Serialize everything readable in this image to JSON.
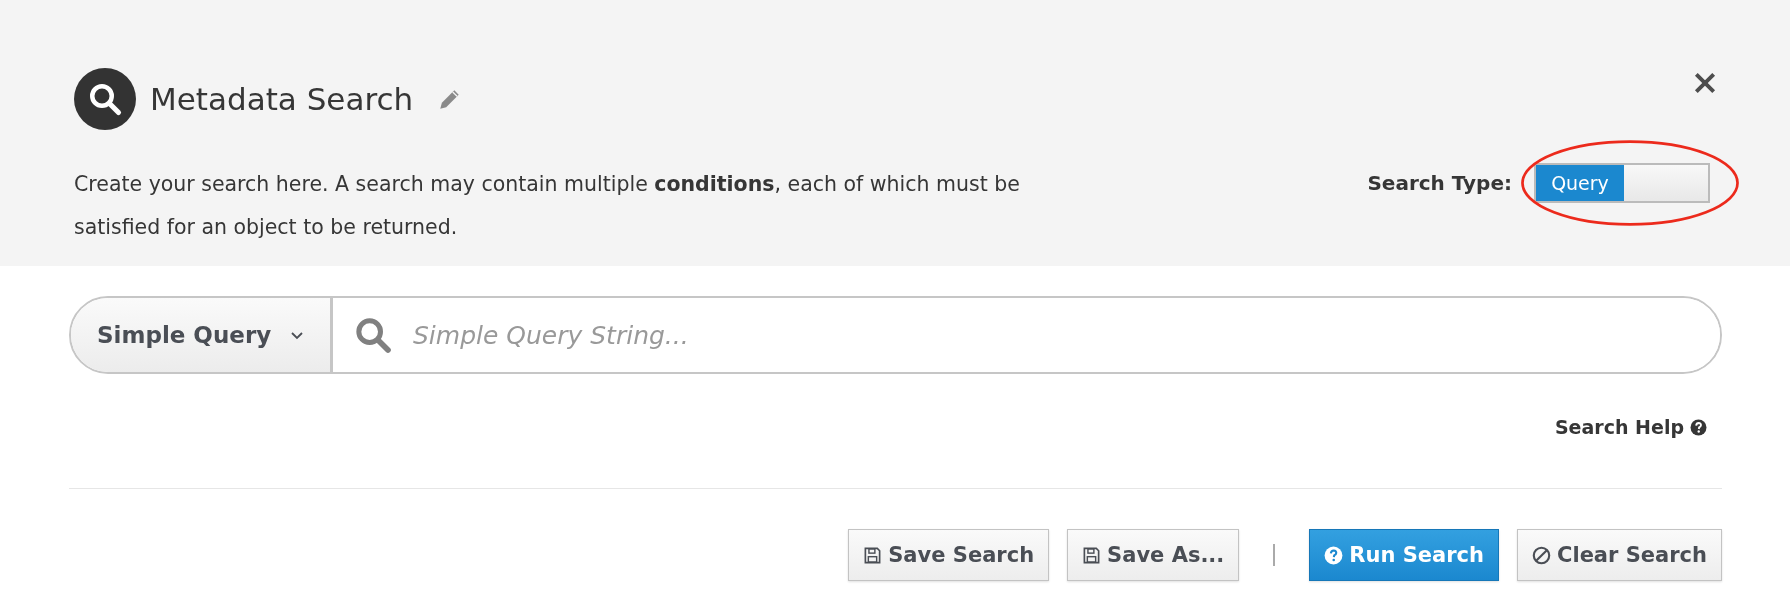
{
  "header": {
    "title": "Metadata Search",
    "description": "Create your search here. A search may contain multiple **conditions**, each of which must be satisfied for an object to be returned."
  },
  "search_type": {
    "label": "Search Type:",
    "switch_label": "Query",
    "on": true,
    "circled": true
  },
  "query": {
    "mode": "Simple Query",
    "placeholder": "Simple Query String..."
  },
  "help_link": "Search Help",
  "buttons": [
    {
      "label": "Save Search",
      "kind": "save",
      "primary": false
    },
    {
      "label": "Save As...",
      "kind": "save",
      "primary": false
    },
    {
      "kind": "separator"
    },
    {
      "label": "Run Search",
      "kind": "help",
      "primary": true
    },
    {
      "label": "Clear Search",
      "kind": "clear",
      "primary": false
    }
  ]
}
